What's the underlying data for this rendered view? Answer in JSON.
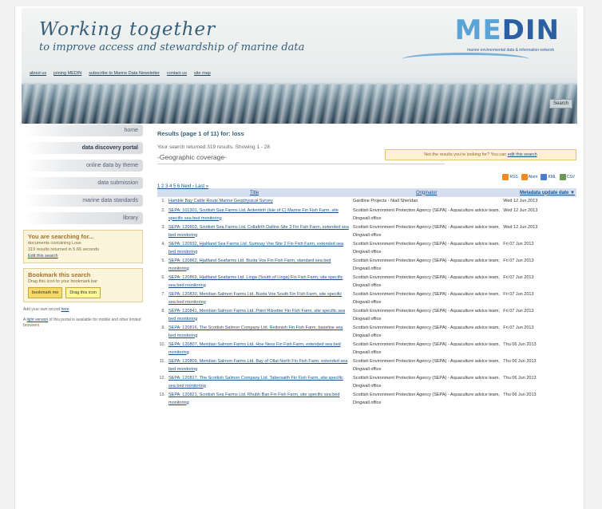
{
  "banner": {
    "title_line1": "Working together",
    "title_line2": "to improve access and stewardship of marine data",
    "logo_prefix": "ME",
    "logo_suffix": "DIN",
    "logo_tagline": "marine environmental data & information network",
    "nav": [
      "about us",
      "joining MEDIN",
      "subscribe to Marine Data Newsletter",
      "contact us",
      "site map"
    ],
    "search_label": "Search"
  },
  "sidebar": {
    "items": [
      {
        "label": "home"
      },
      {
        "label": "data discovery portal"
      },
      {
        "label": "online data by theme"
      },
      {
        "label": "data submission"
      },
      {
        "label": "marine data standards"
      },
      {
        "label": "library"
      }
    ],
    "search_box": {
      "heading": "You are searching for...",
      "line1": "documents containing Loss",
      "line2": "319 results returned in 5.66 seconds",
      "edit_link": "Edit this search"
    },
    "bookmark_box": {
      "heading": "Bookmark this search",
      "line1": "Drag this icon to your bookmark bar",
      "button1": "bookmark me",
      "button2": "Drag this icon"
    },
    "note1_prefix": "Add your own record ",
    "note1_link": "here",
    "note2_prefix": "A ",
    "note2_link": "light version",
    "note2_suffix": " of this portal is available for mobile and other limited browsers"
  },
  "results": {
    "title": "Results (page 1 of 11) for: loss",
    "count_text": "Your search returned 319 results. Showing 1 - 28",
    "not_found_text": "Not the results you're looking for? You can ",
    "not_found_link": "edit this search",
    "geo_label": "-Geographic coverage-",
    "pager": "1 2 3 4 5 6 Next › Last »",
    "exports": [
      "RSS",
      "Atom",
      "KML",
      "CSV"
    ],
    "columns": {
      "title": "Title",
      "organisation": "Originator",
      "date": "Metadata update date ▼"
    },
    "rows": [
      {
        "n": "1.",
        "title": "Hamble Bay Cable Route Marine Geophysical Survey",
        "org": "Gardline Projects - Niall Sheridan",
        "date": "Wed 12 Jun 2013"
      },
      {
        "n": "2.",
        "title": "SEPA: 101301, Scottish Sea Farms Ltd. Ardentinh (Isle of C) Marine Fin Fish Farm, site specific sea bed monitoring",
        "org": "Scottish Environment Protection Agency (SEPA) - Aquaculture advice team, Dingwall office",
        "date": "Wed 12 Jun 2013"
      },
      {
        "n": "3.",
        "title": "SEPA: 120603, Scottish Sea Farms Ltd. Collafirth Dallins Site 3 Fin Fish Farm, extended sea bed monitoring",
        "org": "Scottish Environment Protection Agency (SEPA) - Aquaculture advice team, Dingwall office",
        "date": "Wed 12 Jun 2013"
      },
      {
        "n": "4.",
        "title": "SEPA: 120932, Hjaltland Sea Farms Ltd. Sumnay Voe Site 2 Fin Fish Farm, extended sea bed monitoring",
        "org": "Scottish Environment Protection Agency (SEPA) - Aquaculture advice team, Dingwall office",
        "date": "Fri 07 Jun 2013"
      },
      {
        "n": "5.",
        "title": "SEPA: 120862, Hjaltland Seafarms Ltd. Busta Voe Fin Fish Farm, standard sea bed monitoring",
        "org": "Scottish Environment Protection Agency (SEPA) - Aquaculture advice team, Dingwall office",
        "date": "Fri 07 Jun 2013"
      },
      {
        "n": "6.",
        "title": "SEPA: 120869, Hjaltland Seafarms Ltd. Linga (South of Linga) Fin Fish Farm, site specific sea bed monitoring",
        "org": "Scottish Environment Protection Agency (SEPA) - Aquaculture advice team, Dingwall office",
        "date": "Fri 07 Jun 2013"
      },
      {
        "n": "7.",
        "title": "SEPA: 120830, Meridian Salmon Farms Ltd. Busta Voe South Fin Fish Farm, site specific sea bed monitoring",
        "org": "Scottish Environment Protection Agency (SEPA) - Aquaculture advice team, Dingwall office",
        "date": "Fri 07 Jun 2013"
      },
      {
        "n": "8.",
        "title": "SEPA: 120841, Meridian Salmon Farms Ltd. Point Ritsetter Fin Fish Farm, site specific sea bed monitoring",
        "org": "Scottish Environment Protection Agency (SEPA) - Aquaculture advice team, Dingwall office",
        "date": "Fri 07 Jun 2013"
      },
      {
        "n": "9.",
        "title": "SEPA: 120816, The Scottish Salmon Company Ltd. Reilsnish Fin Fish Farm, baseline sea bed monitoring",
        "org": "Scottish Environment Protection Agency (SEPA) - Aquaculture advice team, Dingwall office",
        "date": "Fri 07 Jun 2013"
      },
      {
        "n": "10.",
        "title": "SEPA: 120807, Meridian Salmon Farms Ltd. Hoe Ness Fin Fish Farm, extended sea bed monitoring",
        "org": "Scottish Environment Protection Agency (SEPA) - Aquaculture advice team, Dingwall office",
        "date": "Thu 06 Jun 2013"
      },
      {
        "n": "11.",
        "title": "SEPA: 120809, Meridian Salmon Farms Ltd. Bay of Ollat North Fin Fish Farm, extended sea bed monitoring",
        "org": "Scottish Environment Protection Agency (SEPA) - Aquaculture advice team, Dingwall office",
        "date": "Thu 06 Jun 2013"
      },
      {
        "n": "12.",
        "title": "SEPA: 120817, The Scottish Salmon Company Ltd. Tabersaith Fin Fish Farm, site specific sea bed monitoring",
        "org": "Scottish Environment Protection Agency (SEPA) - Aquaculture advice team, Dingwall office",
        "date": "Thu 06 Jun 2013"
      },
      {
        "n": "13.",
        "title": "SEPA: 120821, Scottish Sea Farms Ltd. Rhubh Ban Fin Fish Farm, site specific sea bed monitoring",
        "org": "Scottish Environment Protection Agency (SEPA) - Aquaculture advice team, Dingwall office",
        "date": "Thu 06 Jun 2013"
      }
    ]
  }
}
